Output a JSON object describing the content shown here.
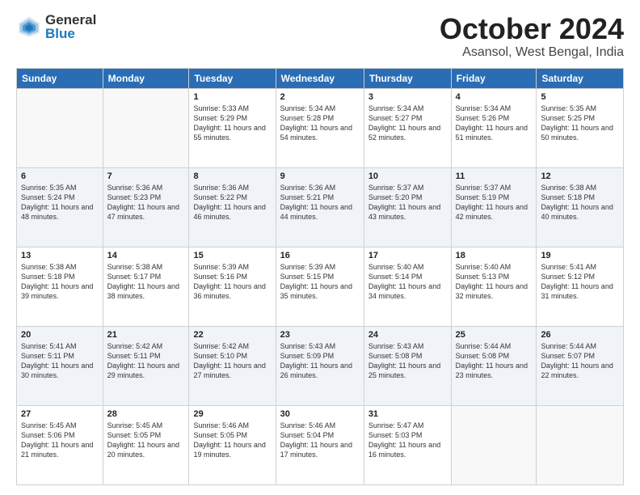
{
  "logo": {
    "general": "General",
    "blue": "Blue"
  },
  "title": "October 2024",
  "location": "Asansol, West Bengal, India",
  "days_of_week": [
    "Sunday",
    "Monday",
    "Tuesday",
    "Wednesday",
    "Thursday",
    "Friday",
    "Saturday"
  ],
  "weeks": [
    [
      {
        "day": "",
        "info": ""
      },
      {
        "day": "",
        "info": ""
      },
      {
        "day": "1",
        "info": "Sunrise: 5:33 AM\nSunset: 5:29 PM\nDaylight: 11 hours and 55 minutes."
      },
      {
        "day": "2",
        "info": "Sunrise: 5:34 AM\nSunset: 5:28 PM\nDaylight: 11 hours and 54 minutes."
      },
      {
        "day": "3",
        "info": "Sunrise: 5:34 AM\nSunset: 5:27 PM\nDaylight: 11 hours and 52 minutes."
      },
      {
        "day": "4",
        "info": "Sunrise: 5:34 AM\nSunset: 5:26 PM\nDaylight: 11 hours and 51 minutes."
      },
      {
        "day": "5",
        "info": "Sunrise: 5:35 AM\nSunset: 5:25 PM\nDaylight: 11 hours and 50 minutes."
      }
    ],
    [
      {
        "day": "6",
        "info": "Sunrise: 5:35 AM\nSunset: 5:24 PM\nDaylight: 11 hours and 48 minutes."
      },
      {
        "day": "7",
        "info": "Sunrise: 5:36 AM\nSunset: 5:23 PM\nDaylight: 11 hours and 47 minutes."
      },
      {
        "day": "8",
        "info": "Sunrise: 5:36 AM\nSunset: 5:22 PM\nDaylight: 11 hours and 46 minutes."
      },
      {
        "day": "9",
        "info": "Sunrise: 5:36 AM\nSunset: 5:21 PM\nDaylight: 11 hours and 44 minutes."
      },
      {
        "day": "10",
        "info": "Sunrise: 5:37 AM\nSunset: 5:20 PM\nDaylight: 11 hours and 43 minutes."
      },
      {
        "day": "11",
        "info": "Sunrise: 5:37 AM\nSunset: 5:19 PM\nDaylight: 11 hours and 42 minutes."
      },
      {
        "day": "12",
        "info": "Sunrise: 5:38 AM\nSunset: 5:18 PM\nDaylight: 11 hours and 40 minutes."
      }
    ],
    [
      {
        "day": "13",
        "info": "Sunrise: 5:38 AM\nSunset: 5:18 PM\nDaylight: 11 hours and 39 minutes."
      },
      {
        "day": "14",
        "info": "Sunrise: 5:38 AM\nSunset: 5:17 PM\nDaylight: 11 hours and 38 minutes."
      },
      {
        "day": "15",
        "info": "Sunrise: 5:39 AM\nSunset: 5:16 PM\nDaylight: 11 hours and 36 minutes."
      },
      {
        "day": "16",
        "info": "Sunrise: 5:39 AM\nSunset: 5:15 PM\nDaylight: 11 hours and 35 minutes."
      },
      {
        "day": "17",
        "info": "Sunrise: 5:40 AM\nSunset: 5:14 PM\nDaylight: 11 hours and 34 minutes."
      },
      {
        "day": "18",
        "info": "Sunrise: 5:40 AM\nSunset: 5:13 PM\nDaylight: 11 hours and 32 minutes."
      },
      {
        "day": "19",
        "info": "Sunrise: 5:41 AM\nSunset: 5:12 PM\nDaylight: 11 hours and 31 minutes."
      }
    ],
    [
      {
        "day": "20",
        "info": "Sunrise: 5:41 AM\nSunset: 5:11 PM\nDaylight: 11 hours and 30 minutes."
      },
      {
        "day": "21",
        "info": "Sunrise: 5:42 AM\nSunset: 5:11 PM\nDaylight: 11 hours and 29 minutes."
      },
      {
        "day": "22",
        "info": "Sunrise: 5:42 AM\nSunset: 5:10 PM\nDaylight: 11 hours and 27 minutes."
      },
      {
        "day": "23",
        "info": "Sunrise: 5:43 AM\nSunset: 5:09 PM\nDaylight: 11 hours and 26 minutes."
      },
      {
        "day": "24",
        "info": "Sunrise: 5:43 AM\nSunset: 5:08 PM\nDaylight: 11 hours and 25 minutes."
      },
      {
        "day": "25",
        "info": "Sunrise: 5:44 AM\nSunset: 5:08 PM\nDaylight: 11 hours and 23 minutes."
      },
      {
        "day": "26",
        "info": "Sunrise: 5:44 AM\nSunset: 5:07 PM\nDaylight: 11 hours and 22 minutes."
      }
    ],
    [
      {
        "day": "27",
        "info": "Sunrise: 5:45 AM\nSunset: 5:06 PM\nDaylight: 11 hours and 21 minutes."
      },
      {
        "day": "28",
        "info": "Sunrise: 5:45 AM\nSunset: 5:05 PM\nDaylight: 11 hours and 20 minutes."
      },
      {
        "day": "29",
        "info": "Sunrise: 5:46 AM\nSunset: 5:05 PM\nDaylight: 11 hours and 19 minutes."
      },
      {
        "day": "30",
        "info": "Sunrise: 5:46 AM\nSunset: 5:04 PM\nDaylight: 11 hours and 17 minutes."
      },
      {
        "day": "31",
        "info": "Sunrise: 5:47 AM\nSunset: 5:03 PM\nDaylight: 11 hours and 16 minutes."
      },
      {
        "day": "",
        "info": ""
      },
      {
        "day": "",
        "info": ""
      }
    ]
  ]
}
